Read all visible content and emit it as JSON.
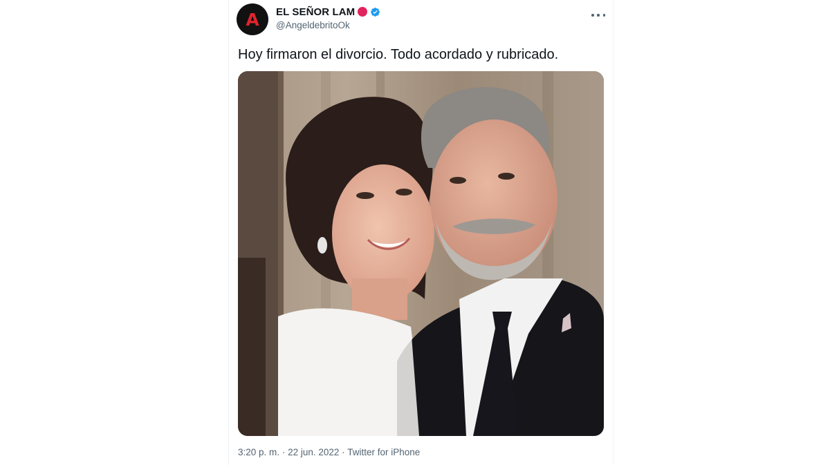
{
  "author": {
    "avatar_letter": "A",
    "display_name": "EL SEÑOR LAM",
    "handle": "@AngeldebritoOk",
    "status_icon": "red-circle-icon",
    "badge_icon": "verified-badge-icon",
    "brand_color": "#e0242c",
    "verified_color": "#1d9bf0"
  },
  "tweet": {
    "text": "Hoy firmaron el divorcio. Todo acordado y rubricado.",
    "media_icon": "photo-couple",
    "time": "3:20 p. m.",
    "separator": "·",
    "date": "22 jun. 2022",
    "source": "Twitter for iPhone"
  },
  "menu": {
    "more_icon": "more-options-icon"
  }
}
